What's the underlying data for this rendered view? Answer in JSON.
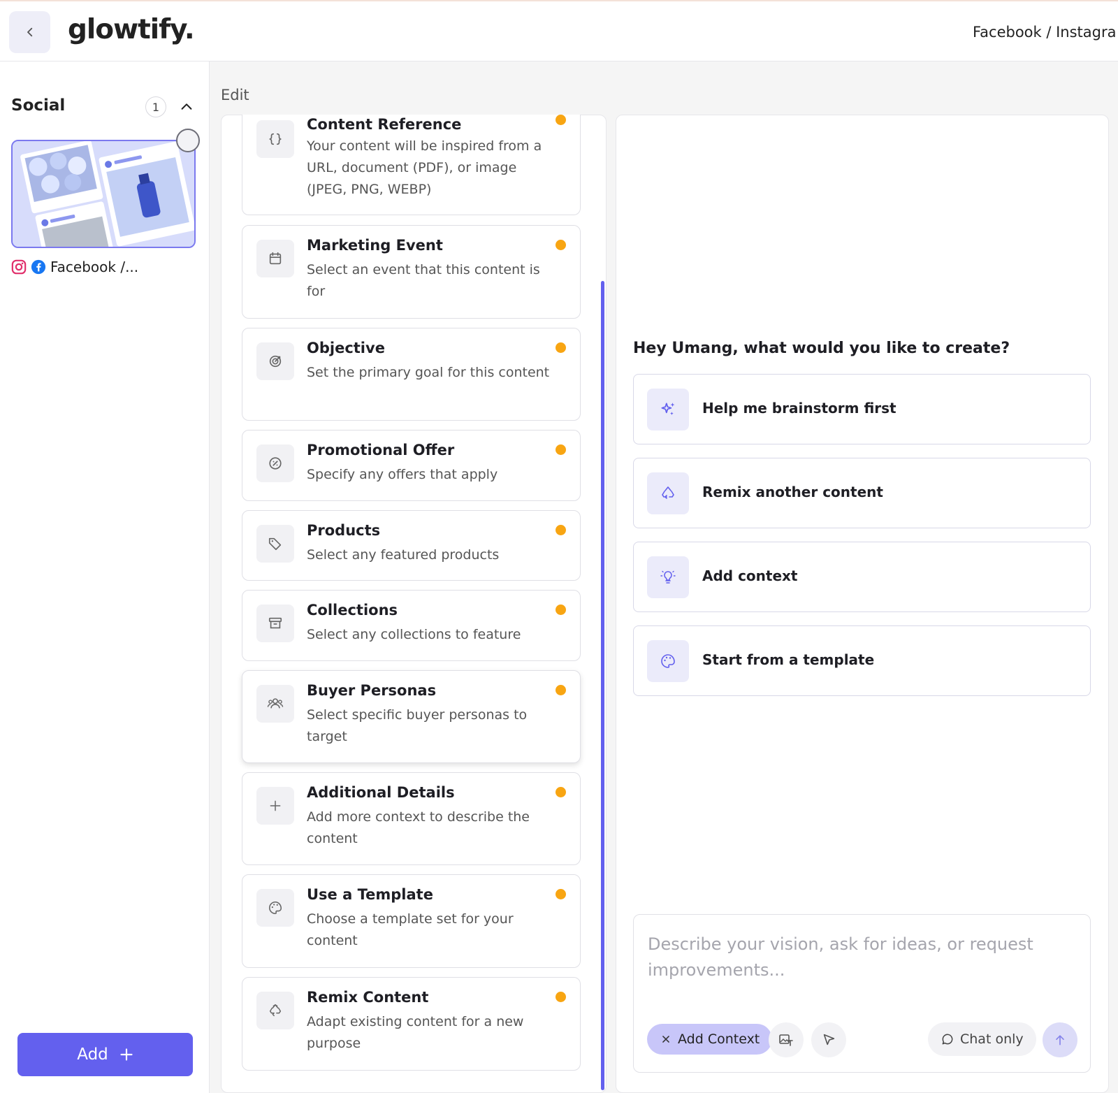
{
  "header": {
    "logo": "glowtify.",
    "channel": "Facebook / Instagra"
  },
  "sidebar": {
    "title": "Social",
    "count": "1",
    "item_caption": "Facebook /...",
    "add_label": "Add",
    "add_icon": "plus-icon"
  },
  "edit": {
    "label": "Edit",
    "cards": [
      {
        "title": "Content Reference",
        "desc": "Your content will be inspired from a URL, document (PDF), or image (JPEG, PNG, WEBP)",
        "icon": "braces-icon"
      },
      {
        "title": "Marketing Event",
        "desc": "Select an event that this content is for",
        "icon": "calendar-icon"
      },
      {
        "title": "Objective",
        "desc": "Set the primary goal for this content",
        "icon": "target-icon"
      },
      {
        "title": "Promotional Offer",
        "desc": "Specify any offers that apply",
        "icon": "percent-badge-icon"
      },
      {
        "title": "Products",
        "desc": "Select any featured products",
        "icon": "tag-icon"
      },
      {
        "title": "Collections",
        "desc": "Select any collections to feature",
        "icon": "archive-icon"
      },
      {
        "title": "Buyer Personas",
        "desc": "Select specific buyer personas to target",
        "icon": "users-icon"
      },
      {
        "title": "Additional Details",
        "desc": "Add more context to describe the content",
        "icon": "plus-icon"
      },
      {
        "title": "Use a Template",
        "desc": "Choose a template set for your content",
        "icon": "palette-icon"
      },
      {
        "title": "Remix Content",
        "desc": "Adapt existing content for a new purpose",
        "icon": "recycle-icon"
      }
    ],
    "status_color": "#f8a512"
  },
  "chat": {
    "greeting": "Hey Umang, what would you like to create?",
    "options": [
      {
        "label": "Help me brainstorm first",
        "icon": "sparkles-icon"
      },
      {
        "label": "Remix another content",
        "icon": "recycle-icon"
      },
      {
        "label": "Add context",
        "icon": "lightbulb-icon"
      },
      {
        "label": "Start from a template",
        "icon": "palette-icon"
      }
    ],
    "input_placeholder": "Describe your vision, ask for ideas, or request improvements...",
    "add_context_chip": "Add Context",
    "chat_only": "Chat only"
  },
  "colors": {
    "accent": "#6360ee",
    "accent_light": "#c8c6f9",
    "status_dot": "#f8a512"
  }
}
